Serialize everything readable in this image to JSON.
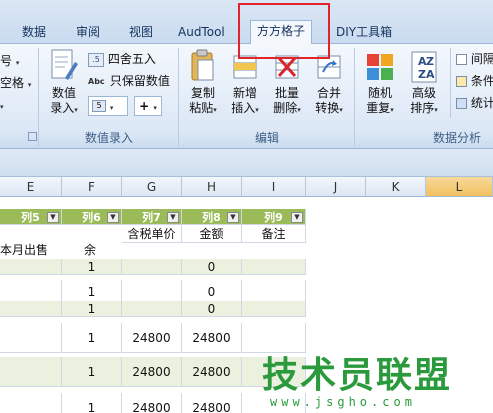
{
  "tabs": [
    {
      "label": "数据"
    },
    {
      "label": "审阅"
    },
    {
      "label": "视图"
    },
    {
      "label": "AudTool"
    },
    {
      "label": "方方格子"
    },
    {
      "label": "DIY工具箱"
    }
  ],
  "active_tab": "方方格子",
  "left_partial": {
    "item1": "号",
    "item2": "空格",
    "caret": "▾"
  },
  "numeric_group": {
    "value_entry": {
      "line1": "数值",
      "line2": "录入"
    },
    "round": "四舍五入",
    "keep_values": "只保留数值",
    "label": "数值录入"
  },
  "edit_group": {
    "copy_paste": {
      "line1": "复制",
      "line2": "粘贴"
    },
    "add_insert": {
      "line1": "新增",
      "line2": "插入"
    },
    "batch_delete": {
      "line1": "批量",
      "line2": "删除"
    },
    "merge_convert": {
      "line1": "合并",
      "line2": "转换"
    },
    "label": "编辑"
  },
  "analysis_group": {
    "random_repeat": {
      "line1": "随机",
      "line2": "重复"
    },
    "advanced_sort": {
      "line1": "高级",
      "line2": "排序"
    },
    "interval": "间隔",
    "condition": "条件",
    "stats": "统计",
    "label": "数据分析"
  },
  "columns": [
    "E",
    "F",
    "G",
    "H",
    "I",
    "J",
    "K",
    "L"
  ],
  "selected_column": "L",
  "table_headers": [
    "列5",
    "列6",
    "列7",
    "列8",
    "列9"
  ],
  "row_titles": {
    "e": "本月出售",
    "f": "余",
    "g": "含税单价",
    "h": "金额",
    "i": "备注"
  },
  "rows": [
    {
      "f": "1",
      "g": "",
      "h": "0"
    },
    {
      "f": "1",
      "g": "",
      "h": "0"
    },
    {
      "f": "1",
      "g": "",
      "h": "0"
    },
    {
      "f": "1",
      "g": "24800",
      "h": "24800"
    },
    {
      "f": "1",
      "g": "24800",
      "h": "24800"
    },
    {
      "f": "1",
      "g": "24800",
      "h": "24800"
    }
  ],
  "watermark": {
    "title": "技术员联盟",
    "url": "www.jsgho.com"
  },
  "colors": {
    "accent": "#e1232b",
    "table_header": "#9bbb59",
    "band": "#ebf1de"
  }
}
